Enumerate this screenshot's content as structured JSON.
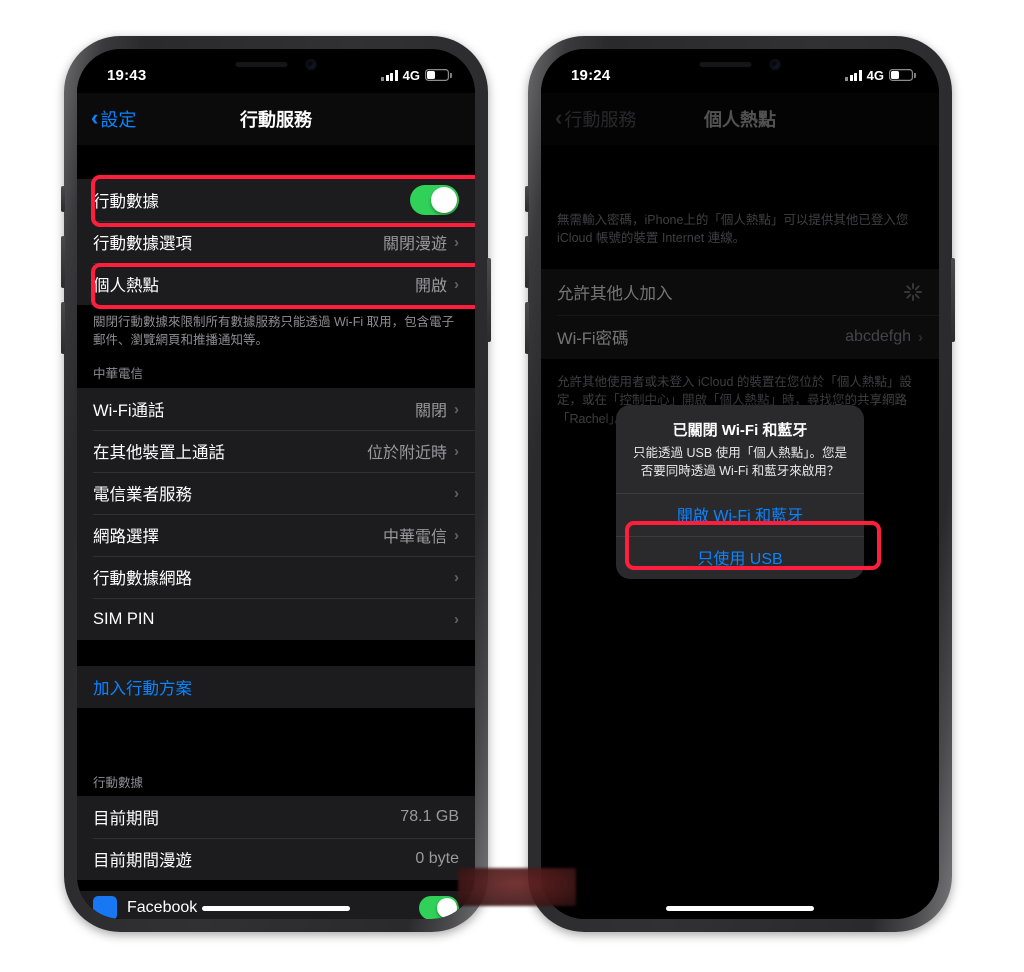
{
  "left_phone": {
    "status_bar": {
      "time": "19:43",
      "network": "4G",
      "signal_bars": 4,
      "battery_percent": 40
    },
    "nav": {
      "back_label": "設定",
      "title": "行動服務",
      "back_icon": "chevron-left-icon",
      "accent": "#0A84FF"
    },
    "group1": [
      {
        "label": "行動數據",
        "control": "toggle",
        "toggle_on": true,
        "highlighted": true
      },
      {
        "label": "行動數據選項",
        "value": "關閉漫遊",
        "chevron": true
      },
      {
        "label": "個人熱點",
        "value": "開啟",
        "chevron": true,
        "highlighted": true
      }
    ],
    "group1_footer": "關閉行動數據來限制所有數據服務只能透過 Wi-Fi 取用，包含電子郵件、瀏覽網頁和推播通知等。",
    "group2_header": "中華電信",
    "group2": [
      {
        "label": "Wi-Fi通話",
        "value": "關閉",
        "chevron": true
      },
      {
        "label": "在其他裝置上通話",
        "value": "位於附近時",
        "chevron": true
      },
      {
        "label": "電信業者服務",
        "value": "",
        "chevron": true
      },
      {
        "label": "網路選擇",
        "value": "中華電信",
        "chevron": true
      },
      {
        "label": "行動數據網路",
        "value": "",
        "chevron": true
      },
      {
        "label": "SIM PIN",
        "value": "",
        "chevron": true
      }
    ],
    "group3": [
      {
        "label": "加入行動方案",
        "link": true
      }
    ],
    "group4_header": "行動數據",
    "group4": [
      {
        "label": "目前期間",
        "value": "78.1 GB"
      },
      {
        "label": "目前期間漫遊",
        "value": "0 byte"
      }
    ],
    "partial_row": {
      "label": "Facebook",
      "icon": "facebook-icon",
      "toggle_on": true
    }
  },
  "right_phone": {
    "status_bar": {
      "time": "19:24",
      "network": "4G",
      "signal_bars": 4,
      "battery_percent": 40
    },
    "nav": {
      "back_label": "行動服務",
      "title": "個人熱點",
      "back_icon": "chevron-left-icon"
    },
    "top_note": "無需輸入密碼，iPhone上的「個人熱點」可以提供其他已登入您 iCloud 帳號的裝置 Internet 連線。",
    "group1": [
      {
        "label": "允許其他人加入",
        "control": "spinner"
      },
      {
        "label": "Wi-Fi密碼",
        "value": "abcdefgh",
        "chevron": true
      }
    ],
    "group1_footer": "允許其他使用者或未登入 iCloud 的裝置在您位於「個人熱點」設定，或在「控制中心」開啟「個人熱點」時，尋找您的共享網路「Rachel」。",
    "alert": {
      "title": "已關閉 Wi-Fi 和藍牙",
      "message": "只能透過 USB 使用「個人熱點」。您是否要同時透過 Wi-Fi 和藍牙來啟用？",
      "primary_button": "開啟 Wi-Fi 和藍牙",
      "secondary_button": "只使用 USB",
      "primary_highlighted": true
    }
  },
  "annotation": {
    "highlight_color": "#FF1F3D",
    "toggle_on_color": "#30D158"
  }
}
